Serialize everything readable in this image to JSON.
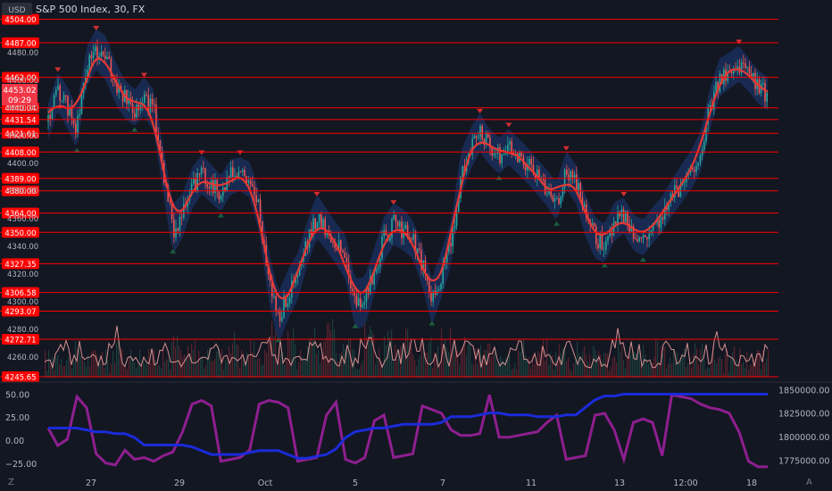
{
  "header": {
    "currency": "USD",
    "title": "S&P 500 Index, 30, FX"
  },
  "price_badge": {
    "price": "4453.02",
    "countdown": "09:29",
    "color": "#f23645"
  },
  "colors": {
    "background": "#131722",
    "level_line": "#ff0000",
    "level_label_bg": "#ff0000",
    "candle_up": "#26a69a",
    "candle_down": "#ef5350",
    "ma_line": "#e53935",
    "band_fill": "#1e3a78",
    "marker_up": "#1b5e3f",
    "marker_down": "#d32f2f",
    "volume_line": "#f4a3a3",
    "oscillator": "#8e1f8f",
    "blue_series": "#1a2bd8",
    "axis_text": "#b2b5be"
  },
  "footer": {
    "left_icon": "Z",
    "right_icon": "A"
  },
  "chart_data": [
    {
      "type": "candlestick",
      "title": "S&P 500 Index, 30, FX",
      "ylim": [
        4245,
        4505
      ],
      "y_ticks": [
        4260,
        4280,
        4300,
        4320,
        4340,
        4360,
        4380,
        4400,
        4420,
        4440,
        4460,
        4480
      ],
      "horizontal_levels": [
        4504.0,
        4487.0,
        4462.0,
        4440.04,
        4431.54,
        4421.61,
        4408.0,
        4389.0,
        4380.0,
        4364.0,
        4350.0,
        4327.35,
        4306.58,
        4293.07,
        4272.71,
        4245.65
      ],
      "x_tick_labels": [
        "27",
        "29",
        "Oct",
        "5",
        "7",
        "11",
        "13",
        "12:00",
        "18"
      ],
      "last_price": 4453.02,
      "price_path": [
        4430,
        4452,
        4440,
        4425,
        4470,
        4482,
        4476,
        4458,
        4446,
        4440,
        4448,
        4438,
        4395,
        4352,
        4362,
        4382,
        4392,
        4385,
        4378,
        4390,
        4392,
        4388,
        4365,
        4318,
        4288,
        4305,
        4318,
        4342,
        4362,
        4352,
        4342,
        4332,
        4298,
        4300,
        4322,
        4345,
        4356,
        4352,
        4345,
        4326,
        4300,
        4320,
        4342,
        4392,
        4410,
        4422,
        4412,
        4405,
        4412,
        4405,
        4398,
        4390,
        4382,
        4372,
        4395,
        4385,
        4362,
        4346,
        4342,
        4358,
        4362,
        4350,
        4346,
        4355,
        4363,
        4375,
        4385,
        4395,
        4408,
        4440,
        4462,
        4467,
        4472,
        4464,
        4455,
        4450
      ],
      "band_half_width": [
        13,
        14,
        15,
        15,
        14,
        15,
        16,
        15,
        14,
        13,
        14,
        15,
        17,
        18,
        16,
        15,
        14,
        14,
        13,
        13,
        12,
        13,
        15,
        18,
        19,
        18,
        17,
        16,
        16,
        15,
        15,
        16,
        18,
        18,
        17,
        16,
        15,
        15,
        14,
        15,
        17,
        17,
        16,
        16,
        15,
        14,
        13,
        13,
        13,
        13,
        13,
        13,
        13,
        14,
        14,
        14,
        15,
        15,
        14,
        14,
        13,
        13,
        13,
        13,
        13,
        13,
        14,
        14,
        15,
        15,
        14,
        13,
        13,
        12,
        12,
        12
      ],
      "volume_path": [
        0.12,
        0.28,
        0.18,
        0.3,
        0.14,
        0.26,
        0.1,
        0.34,
        0.2,
        0.24,
        0.12,
        0.3,
        0.16,
        0.52,
        0.22,
        0.42,
        0.14,
        0.32,
        0.18,
        0.62,
        0.2,
        0.44,
        0.16,
        0.86,
        0.3,
        0.74,
        0.22,
        0.68,
        0.34,
        0.88,
        0.26,
        0.7,
        0.18,
        0.84,
        0.3,
        0.6,
        0.22,
        0.72,
        0.26,
        0.52,
        0.2,
        0.64,
        0.28,
        0.46,
        0.16,
        0.38,
        0.12,
        0.36,
        0.2,
        0.44,
        0.14,
        0.4,
        0.18,
        0.36,
        0.12,
        0.46,
        0.22,
        0.34,
        0.14,
        0.3,
        0.18,
        0.28,
        0.1,
        0.34,
        0.2,
        0.26,
        0.12,
        0.32,
        0.16,
        0.24,
        0.1,
        0.22,
        0.14,
        0.2,
        0.1,
        0.12
      ]
    },
    {
      "type": "line",
      "title": "",
      "left_axis": {
        "ticks": [
          50.0,
          25.0,
          0.0,
          -25.0
        ],
        "tick_labels": [
          "50.00",
          "25.00",
          "0.00",
          "−25.00"
        ],
        "ylim": [
          -32,
          60
        ]
      },
      "right_axis": {
        "ticks": [
          1850000,
          1825000,
          1800000,
          1775000
        ],
        "tick_labels": [
          "1850000.00",
          "1825000.00",
          "1800000.00",
          "1775000.00"
        ],
        "ylim": [
          1765000,
          1855000
        ]
      },
      "series": [
        {
          "axis": "left",
          "values": [
            14,
            -5,
            2,
            48,
            36,
            -14,
            -24,
            -26,
            -10,
            -20,
            -18,
            -22,
            -16,
            -12,
            10,
            40,
            44,
            38,
            -22,
            -20,
            -18,
            -10,
            40,
            44,
            42,
            36,
            -22,
            -20,
            -18,
            28,
            42,
            -20,
            -24,
            -18,
            22,
            28,
            -18,
            -16,
            -14,
            38,
            34,
            30,
            12,
            6,
            6,
            8,
            50,
            4,
            4,
            6,
            8,
            10,
            20,
            28,
            -20,
            -18,
            -16,
            28,
            30,
            12,
            -20,
            20,
            24,
            20,
            -16,
            50,
            48,
            46,
            40,
            36,
            34,
            30,
            10,
            -22,
            -28,
            -28
          ]
        },
        {
          "axis": "right",
          "values": [
            1810000,
            1810000,
            1810000,
            1810000,
            1808000,
            1806000,
            1806000,
            1804000,
            1804000,
            1800000,
            1792000,
            1792000,
            1792000,
            1792000,
            1792000,
            1790000,
            1786000,
            1782000,
            1782000,
            1782000,
            1782000,
            1784000,
            1786000,
            1786000,
            1786000,
            1782000,
            1778000,
            1778000,
            1780000,
            1782000,
            1788000,
            1800000,
            1806000,
            1808000,
            1810000,
            1810000,
            1812000,
            1814000,
            1814000,
            1814000,
            1814000,
            1816000,
            1822000,
            1822000,
            1822000,
            1824000,
            1826000,
            1826000,
            1824000,
            1824000,
            1824000,
            1822000,
            1822000,
            1822000,
            1824000,
            1824000,
            1832000,
            1840000,
            1844000,
            1844000,
            1846000,
            1846000,
            1846000,
            1846000,
            1846000,
            1846000,
            1846000,
            1846000,
            1846000,
            1846000,
            1846000,
            1846000,
            1846000,
            1846000,
            1846000,
            1846000
          ]
        }
      ]
    }
  ]
}
